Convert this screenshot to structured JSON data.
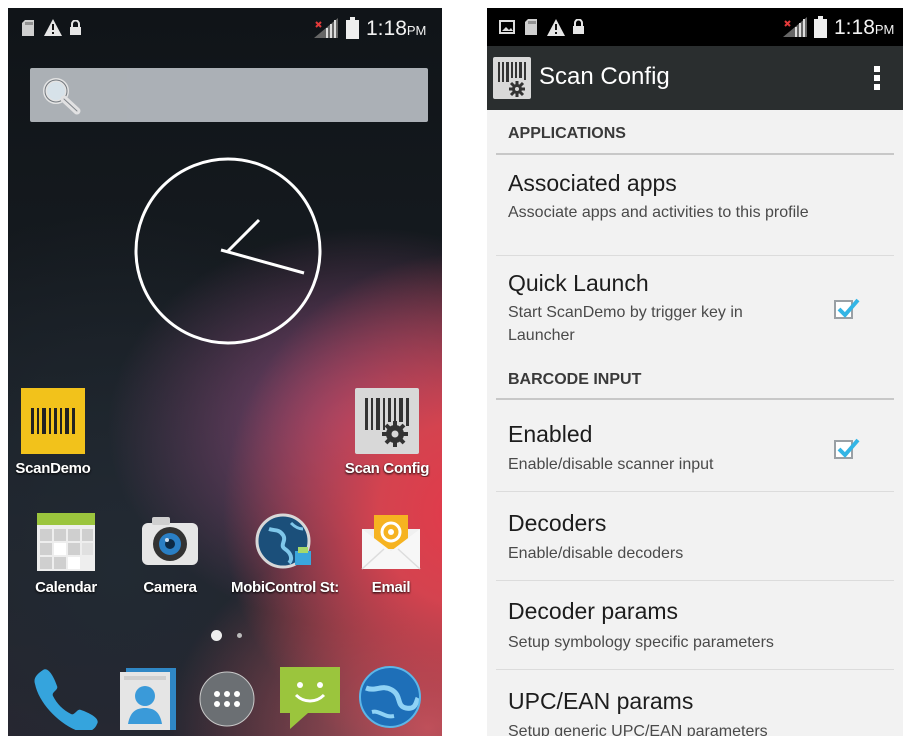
{
  "home": {
    "status": {
      "time": "1:18",
      "ampm": "PM",
      "icons": [
        "sd-card-icon",
        "warning-icon",
        "lock-icon",
        "no-sim-signal-icon",
        "battery-icon"
      ]
    },
    "search_icon": "search-icon",
    "apps_row1": [
      {
        "label": "ScanDemo",
        "icon": "barcode-icon"
      },
      {
        "label": "Scan Config",
        "icon": "barcode-gear-icon"
      }
    ],
    "apps_row2": [
      {
        "label": "Calendar",
        "icon": "calendar-icon"
      },
      {
        "label": "Camera",
        "icon": "camera-icon"
      },
      {
        "label": "MobiControl St:",
        "icon": "globe-icon"
      },
      {
        "label": "Email",
        "icon": "email-icon"
      }
    ],
    "dock": [
      "phone-icon",
      "contacts-icon",
      "app-drawer-icon",
      "messaging-icon",
      "browser-icon"
    ]
  },
  "scanconfig": {
    "status": {
      "time": "1:18",
      "ampm": "PM"
    },
    "title": "Scan Config",
    "categories": {
      "applications": "APPLICATIONS",
      "barcode_input": "BARCODE INPUT"
    },
    "prefs": [
      {
        "title": "Associated apps",
        "summary": "Associate apps and activities to this profile"
      },
      {
        "title": "Quick Launch",
        "summary": "Start ScanDemo by trigger key in Launcher",
        "checked": true
      },
      {
        "title": "Enabled",
        "summary": "Enable/disable scanner input",
        "checked": true
      },
      {
        "title": "Decoders",
        "summary": "Enable/disable decoders"
      },
      {
        "title": "Decoder params",
        "summary": "Setup symbology specific parameters"
      },
      {
        "title": "UPC/EAN params",
        "summary": "Setup generic UPC/EAN parameters"
      }
    ],
    "accent": "#33b5e5"
  }
}
